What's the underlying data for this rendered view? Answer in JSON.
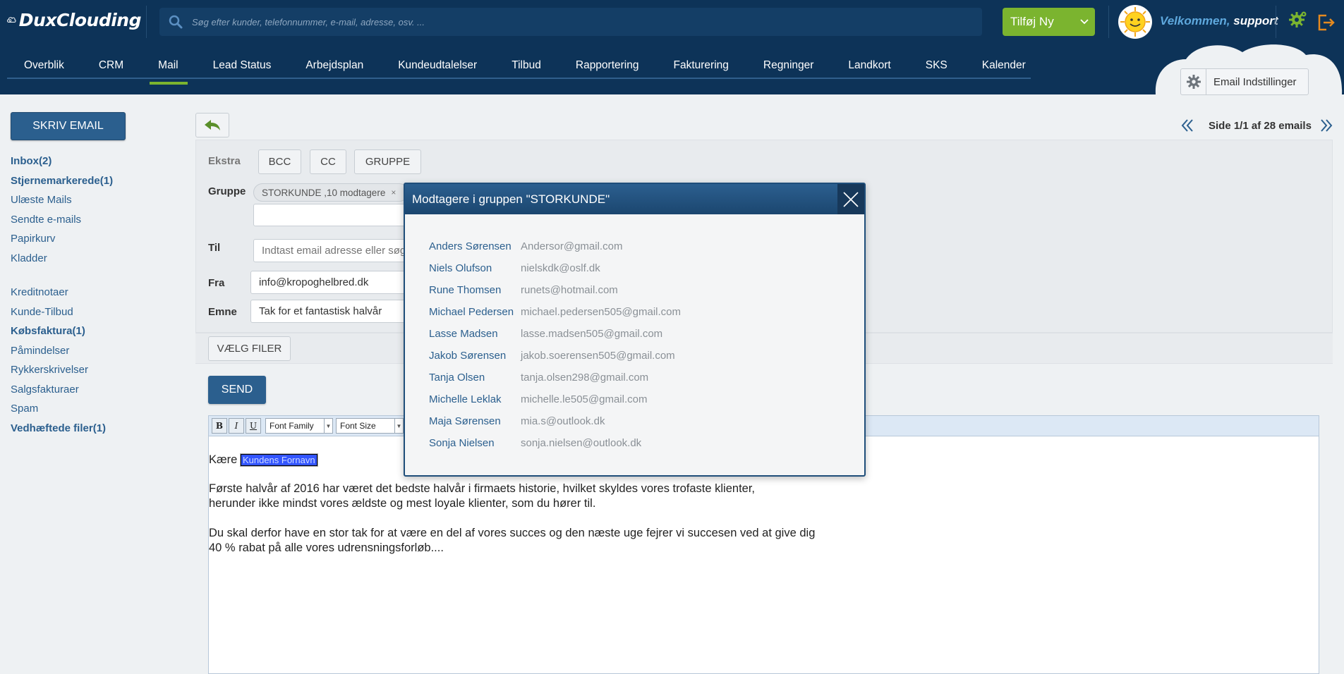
{
  "app": {
    "logo_text": "DuxClouding",
    "search_placeholder": "Søg efter kunder, telefonnummer, e-mail, adresse, osv. ...",
    "add_new_label": "Tilføj Ny",
    "welcome_prefix": "Velkommen,",
    "welcome_user": "support"
  },
  "nav": {
    "items": [
      {
        "label": "Overblik"
      },
      {
        "label": "CRM"
      },
      {
        "label": "Mail"
      },
      {
        "label": "Lead Status"
      },
      {
        "label": "Arbejdsplan"
      },
      {
        "label": "Kundeudtalelser"
      },
      {
        "label": "Tilbud"
      },
      {
        "label": "Rapportering"
      },
      {
        "label": "Fakturering"
      },
      {
        "label": "Regninger"
      },
      {
        "label": "Landkort"
      },
      {
        "label": "SKS"
      },
      {
        "label": "Kalender"
      }
    ],
    "active_index": 2,
    "email_settings_label": "Email Indstillinger"
  },
  "sidebar": {
    "compose_label": "SKRIV EMAIL",
    "group1": [
      {
        "label": "Inbox(2)",
        "bold": true
      },
      {
        "label": "Stjernemarkerede(1)",
        "bold": true
      },
      {
        "label": "Ulæste Mails",
        "bold": false
      },
      {
        "label": "Sendte e-mails",
        "bold": false
      },
      {
        "label": "Papirkurv",
        "bold": false
      },
      {
        "label": "Kladder",
        "bold": false
      }
    ],
    "group2": [
      {
        "label": "Kreditnotaer",
        "bold": false
      },
      {
        "label": "Kunde-Tilbud",
        "bold": false
      },
      {
        "label": "Købsfaktura(1)",
        "bold": true
      },
      {
        "label": "Påmindelser",
        "bold": false
      },
      {
        "label": "Rykkerskrivelser",
        "bold": false
      },
      {
        "label": "Salgsfakturaer",
        "bold": false
      },
      {
        "label": "Spam",
        "bold": false
      },
      {
        "label": "Vedhæftede filer(1)",
        "bold": true
      }
    ]
  },
  "pager": {
    "text": "Side 1/1 af 28 emails"
  },
  "compose": {
    "extra_label": "Ekstra",
    "bcc_label": "BCC",
    "cc_label": "CC",
    "group_btn_label": "GRUPPE",
    "group_label": "Gruppe",
    "group_tag": "STORKUNDE ,10 modtagere",
    "group_tag_remove": "×",
    "to_label": "Til",
    "to_placeholder": "Indtast email adresse eller søg",
    "from_label": "Fra",
    "from_value": "info@kropoghelbred.dk",
    "subject_label": "Emne",
    "subject_value": "Tak for et fantastisk halvår",
    "choose_files_label": "VÆLG FILER",
    "send_label": "SEND"
  },
  "editor": {
    "bold": "B",
    "italic": "I",
    "underline": "U",
    "font_family": "Font Family",
    "font_size": "Font Size",
    "greeting": "Kære",
    "placeholder_chip": "Kundens Fornavn",
    "para1_line1": "Første halvår af 2016 har været det bedste halvår i firmaets historie, hvilket skyldes vores trofaste klienter,",
    "para1_line2": "herunder ikke mindst vores ældste og mest loyale klienter, som du hører til.",
    "para2_line1": "Du skal derfor have en stor tak for at være en del af vores succes og den næste uge fejrer vi succesen ved at give dig",
    "para2_line2": "40 % rabat på alle vores udrensningsforløb...."
  },
  "modal": {
    "title": "Modtagere i gruppen \"STORKUNDE\"",
    "recipients": [
      {
        "name": "Anders Sørensen",
        "email": "Andersor@gmail.com"
      },
      {
        "name": "Niels Olufson",
        "email": "nielskdk@oslf.dk"
      },
      {
        "name": "Rune Thomsen",
        "email": "runets@hotmail.com"
      },
      {
        "name": "Michael Pedersen",
        "email": "michael.pedersen505@gmail.com"
      },
      {
        "name": "Lasse Madsen",
        "email": "lasse.madsen505@gmail.com"
      },
      {
        "name": "Jakob Sørensen",
        "email": "jakob.soerensen505@gmail.com"
      },
      {
        "name": "Tanja Olsen",
        "email": "tanja.olsen298@gmail.com"
      },
      {
        "name": "Michelle Leklak",
        "email": "michelle.le505@gmail.com"
      },
      {
        "name": "Maja Sørensen",
        "email": "mia.s@outlook.dk"
      },
      {
        "name": "Sonja Nielsen",
        "email": "sonja.nielsen@outlook.dk"
      }
    ]
  },
  "colors": {
    "header_bg": "#0d3358",
    "accent_green": "#7bb42f",
    "primary_blue": "#2b5f8e"
  }
}
